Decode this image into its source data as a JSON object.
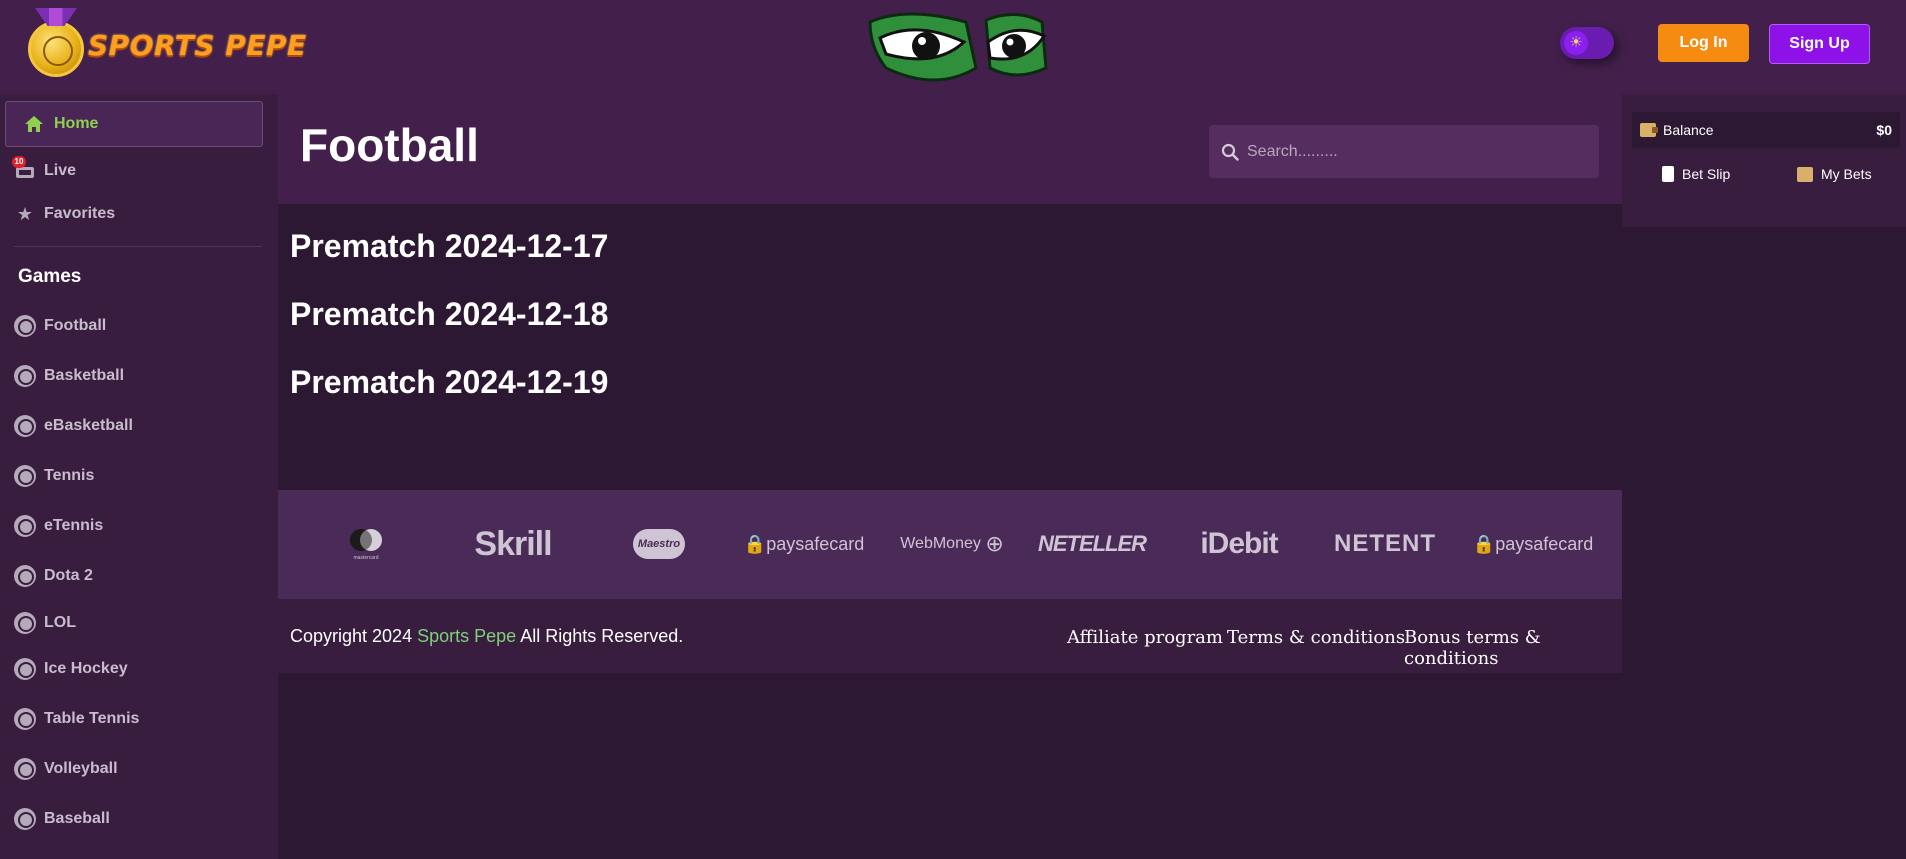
{
  "header": {
    "brand": "SPORTS PEPE",
    "login_label": "Log In",
    "signup_label": "Sign Up",
    "theme_toggle_icon": "sun-icon"
  },
  "sidebar": {
    "primary": [
      {
        "label": "Home",
        "icon": "home-icon",
        "active": true
      },
      {
        "label": "Live",
        "icon": "live-icon",
        "badge": "10"
      },
      {
        "label": "Favorites",
        "icon": "star-icon"
      }
    ],
    "games_title": "Games",
    "games": [
      {
        "label": "Football",
        "icon": "football-icon"
      },
      {
        "label": "Basketball",
        "icon": "basketball-icon"
      },
      {
        "label": "eBasketball",
        "icon": "basketball-icon"
      },
      {
        "label": "Tennis",
        "icon": "tennis-icon"
      },
      {
        "label": "eTennis",
        "icon": "tennis-icon"
      },
      {
        "label": "Dota 2",
        "icon": "dota-icon"
      },
      {
        "label": "LOL",
        "icon": "star-icon"
      },
      {
        "label": "Ice Hockey",
        "icon": "hockey-puck-icon"
      },
      {
        "label": "Table Tennis",
        "icon": "table-tennis-icon"
      },
      {
        "label": "Volleyball",
        "icon": "volleyball-icon"
      },
      {
        "label": "Baseball",
        "icon": "baseball-icon"
      }
    ]
  },
  "main": {
    "title": "Football",
    "search_placeholder": "Search.........",
    "prematch": [
      "Prematch 2024-12-17",
      "Prematch 2024-12-18",
      "Prematch 2024-12-19"
    ]
  },
  "payments": [
    "mastercard",
    "Skrill",
    "Maestro",
    "paysafecard",
    "WebMoney",
    "NETELLER",
    "iDebit",
    "NETENT",
    "paysafecard"
  ],
  "footer": {
    "copyright_prefix": "Copyright 2024",
    "copyright_brand": "Sports Pepe",
    "copyright_suffix": "All Rights Reserved.",
    "links": [
      "Affiliate program",
      "Terms & conditions",
      "Bonus terms & conditions"
    ]
  },
  "betslip": {
    "balance_label": "Balance",
    "balance_value": "$0",
    "tab_betslip": "Bet Slip",
    "tab_mybets": "My Bets"
  },
  "colors": {
    "header_bg": "#43204c",
    "body_bg": "#2c1832",
    "sidebar_bg": "#381d3f",
    "active_green": "#8fd14f",
    "login_orange": "#f68b12",
    "signup_purple": "#8e12e8"
  }
}
